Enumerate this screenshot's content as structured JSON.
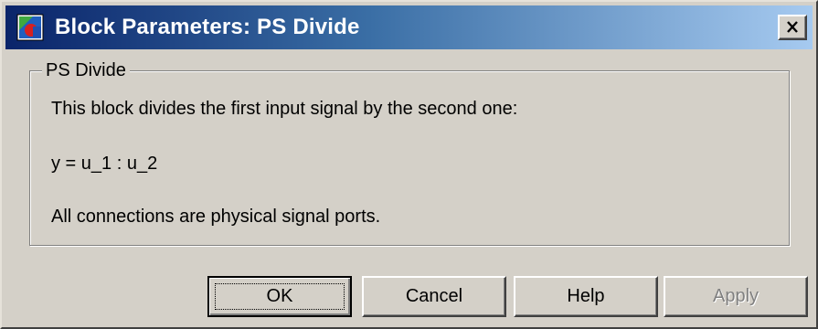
{
  "window": {
    "title": "Block Parameters:  PS Divide"
  },
  "group": {
    "legend": "PS Divide",
    "description_lines": [
      "This block divides the first input signal by the second one:",
      "y = u_1 : u_2",
      "All connections are physical signal ports."
    ]
  },
  "buttons": {
    "ok": "OK",
    "cancel": "Cancel",
    "help": "Help",
    "apply": "Apply"
  },
  "icons": {
    "app": "simulink-block-icon",
    "close": "close-icon"
  },
  "colors": {
    "titlebar_start": "#0a246a",
    "titlebar_end": "#a6caf0",
    "face": "#d4d0c8",
    "disabled_text": "#808080"
  }
}
